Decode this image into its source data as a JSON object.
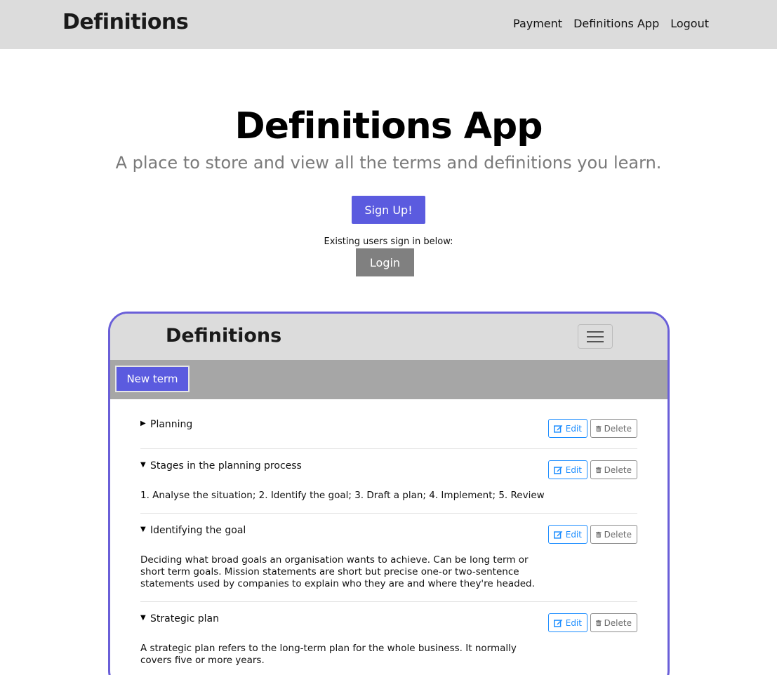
{
  "nav": {
    "brand": "Definitions",
    "links": [
      "Payment",
      "Definitions App",
      "Logout"
    ]
  },
  "hero": {
    "title": "Definitions App",
    "subtitle": "A place to store and view all the terms and definitions you learn.",
    "signup_label": "Sign Up!",
    "existing_text": "Existing users sign in below:",
    "login_label": "Login"
  },
  "preview": {
    "brand": "Definitions",
    "new_term_label": "New term",
    "edit_label": "Edit",
    "delete_label": "Delete",
    "terms": [
      {
        "title": "Planning",
        "expanded": false,
        "definition": ""
      },
      {
        "title": "Stages in the planning process",
        "expanded": true,
        "definition": "1. Analyse the situation; 2. Identify the goal; 3. Draft a plan; 4. Implement; 5. Review"
      },
      {
        "title": "Identifying the goal",
        "expanded": true,
        "definition": "Deciding what broad goals an organisation wants to achieve. Can be long term or short term goals. Mission statements are short but precise one-or two-sentence statements used by companies to explain who they are and where they're headed."
      },
      {
        "title": "Strategic plan",
        "expanded": true,
        "definition": "A strategic plan refers to the long-term plan for the whole business. It normally covers five or more years."
      }
    ]
  },
  "colors": {
    "accent": "#5b5bdf",
    "frame_border": "#6a5fd8",
    "edit_blue": "#1a8cff",
    "nav_bg": "#dcdcdc",
    "toolbar_bg": "#a6a6a6"
  }
}
